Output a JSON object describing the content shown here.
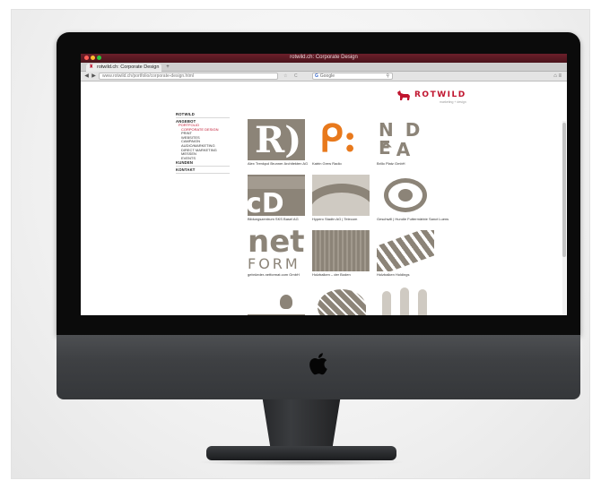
{
  "browser": {
    "window_title": "rotwild.ch: Corporate Design",
    "tab_title": "rotwild.ch: Corporate Design",
    "new_tab": "+",
    "address_value": "www.rotwild.ch/portfolio/corporate-design.html",
    "search_placeholder": "Google",
    "search_engine_icon": "G",
    "controls": {
      "back": "◀",
      "forward": "▶",
      "reload": "C",
      "star": "☆",
      "search": "⚲",
      "home": "⌂",
      "menu": "≡"
    }
  },
  "brand": {
    "name": "ROTWILD",
    "tagline": "marketing + design"
  },
  "nav": [
    {
      "label": "ROTWILD",
      "type": "top",
      "rule": true
    },
    {
      "label": "ANGEBOT",
      "type": "top"
    },
    {
      "label": "PORTFOLIO",
      "type": "level1"
    },
    {
      "label": "CORPORATE DESIGN",
      "type": "sub",
      "active": true
    },
    {
      "label": "PRINT",
      "type": "sub"
    },
    {
      "label": "WEBSITES",
      "type": "sub"
    },
    {
      "label": "CAMPAIGN",
      "type": "sub"
    },
    {
      "label": "AUDIO/MARKETING",
      "type": "sub"
    },
    {
      "label": "DIRECT MARKETING",
      "type": "sub"
    },
    {
      "label": "MESSEN",
      "type": "sub"
    },
    {
      "label": "EVENTS",
      "type": "sub",
      "rule": true
    },
    {
      "label": "KUNDEN",
      "type": "top",
      "rule": true
    },
    {
      "label": "KONTAKT",
      "type": "top",
      "rule": true
    }
  ],
  "portfolio": [
    {
      "caption": "Alex Trenkpol Brunner Architekten AG",
      "art": "R)"
    },
    {
      "caption": "Katrin Grew Radio",
      "art": "ear"
    },
    {
      "caption": "Brillo Platz GmbH",
      "art": "N D E"
    },
    {
      "caption": "Bildungszentrum SKS Basel AG",
      "art": "CD"
    },
    {
      "caption": "Hypero Stadtn AG | Telecom",
      "art": "arch"
    },
    {
      "caption": "Geschwill | Hundle Futtermärkte Sanct Luens",
      "art": "vinyl"
    },
    {
      "caption": "gebrüeder-netformat.com GmbH",
      "art": "net FORM"
    },
    {
      "caption": "Holzbalken – der Boden",
      "art": "wood"
    },
    {
      "caption": "Holzbalken Holdings",
      "art": "rail"
    },
    {
      "caption": "",
      "art": "bird"
    },
    {
      "caption": "",
      "art": "leaf"
    },
    {
      "caption": "",
      "art": "bars"
    }
  ],
  "colors": {
    "brand_red": "#c0152f",
    "thumb_gray": "#8c8478",
    "dark": "#0b0b0b"
  }
}
